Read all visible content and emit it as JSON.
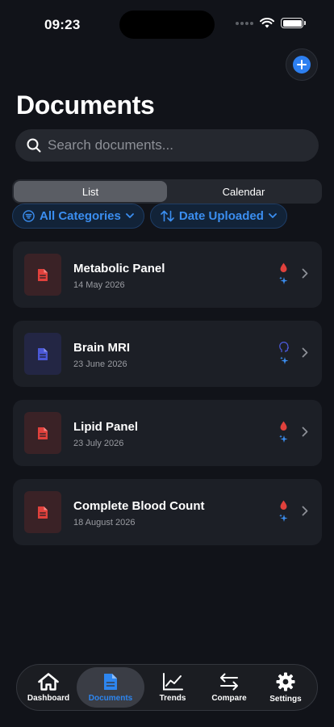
{
  "status": {
    "time": "09:23"
  },
  "header": {
    "title": "Documents"
  },
  "search": {
    "placeholder": "Search documents..."
  },
  "view_toggle": {
    "options": [
      "List",
      "Calendar"
    ],
    "selected": "List"
  },
  "filters": {
    "category": "All Categories",
    "sort": "Date Uploaded"
  },
  "documents": [
    {
      "title": "Metabolic Panel",
      "date": "14 May 2026",
      "category_icon": "blood-drop-icon",
      "color": "red"
    },
    {
      "title": "Brain MRI",
      "date": "23 June 2026",
      "category_icon": "head-icon",
      "color": "blue"
    },
    {
      "title": "Lipid Panel",
      "date": "23 July 2026",
      "category_icon": "blood-drop-icon",
      "color": "red"
    },
    {
      "title": "Complete Blood Count",
      "date": "18 August 2026",
      "category_icon": "blood-drop-icon",
      "color": "red"
    }
  ],
  "tabs": [
    {
      "label": "Dashboard",
      "icon": "house-icon"
    },
    {
      "label": "Documents",
      "icon": "document-icon"
    },
    {
      "label": "Trends",
      "icon": "chart-icon"
    },
    {
      "label": "Compare",
      "icon": "arrows-icon"
    },
    {
      "label": "Settings",
      "icon": "gear-icon"
    }
  ],
  "active_tab": "Documents",
  "colors": {
    "accent": "#2d86f0",
    "red": "#e0413c",
    "blue": "#4a58d6",
    "background": "#111319"
  }
}
